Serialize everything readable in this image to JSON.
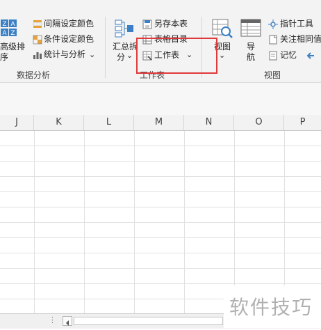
{
  "ribbon": {
    "data_analysis": {
      "sort_advanced_line1": "高级排",
      "sort_advanced_line2": "序",
      "interval_color": "间隔设定颜色",
      "conditional_color": "条件设定颜色",
      "stats_analysis": "统计与分析",
      "group_label": "数据分析"
    },
    "worksheet": {
      "summary_line1": "汇总拆",
      "summary_line2": "分",
      "save_sheet": "另存本表",
      "table_directory": "表格目录",
      "worksheet_menu": "工作表",
      "group_label": "工作表"
    },
    "view": {
      "view_label": "视图",
      "nav_line1": "导",
      "nav_line2": "航",
      "pointer_tool": "指针工具",
      "focus_same": "关注相同值",
      "memory": "记忆",
      "group_label": "视图"
    }
  },
  "columns": [
    "J",
    "K",
    "L",
    "M",
    "N",
    "O",
    "P"
  ],
  "watermark": "软件技巧"
}
